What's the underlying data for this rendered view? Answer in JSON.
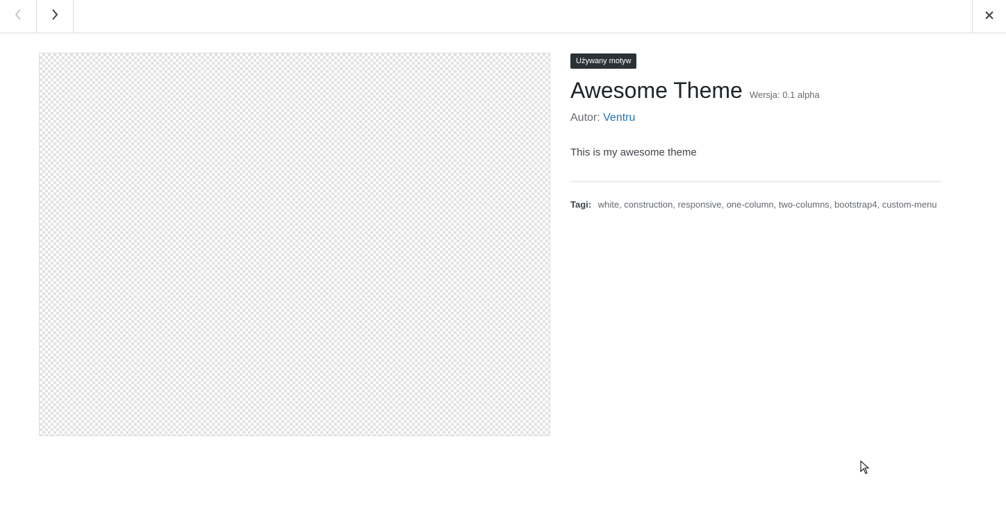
{
  "header": {
    "prev_icon": "chevron-left-icon",
    "next_icon": "chevron-right-icon",
    "close_icon": "close-icon"
  },
  "theme": {
    "badge": "Używany motyw",
    "name": "Awesome Theme",
    "version": "Wersja: 0.1 alpha",
    "author_label": "Autor:",
    "author_name": "Ventru",
    "description": "This is my awesome theme",
    "tags_label": "Tagi:",
    "tags": "white, construction, responsive, one-column, two-columns, bootstrap4, custom-menu"
  },
  "colors": {
    "link": "#2271b1",
    "badge_bg": "#2c3338",
    "border": "#dcdcde"
  }
}
